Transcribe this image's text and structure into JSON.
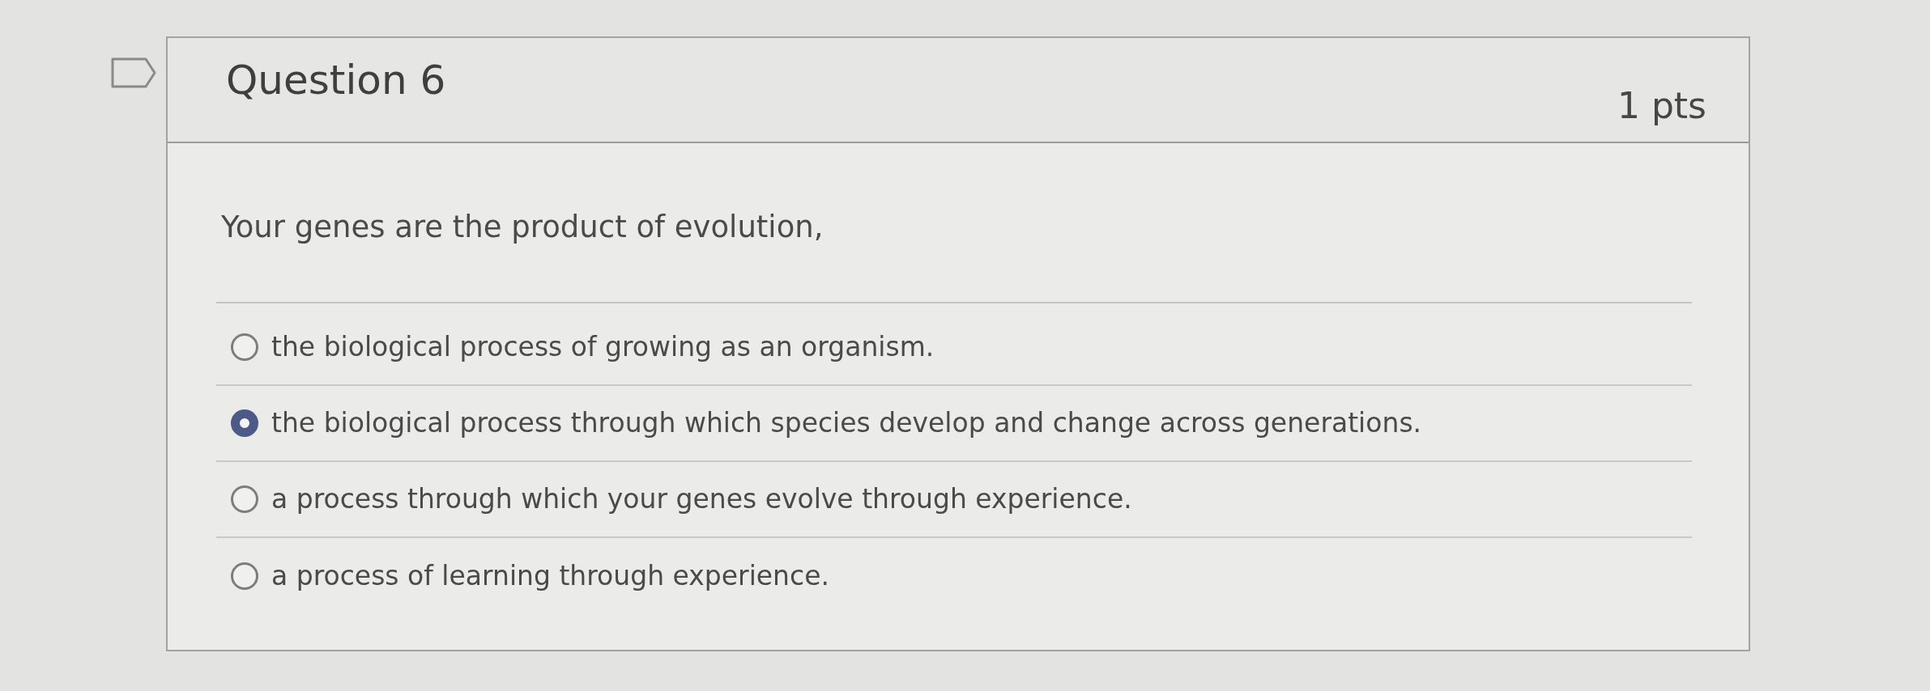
{
  "question": {
    "title": "Question 6",
    "points": "1 pts",
    "text": "Your genes are the product of evolution,",
    "answers": [
      {
        "label": "the biological process of growing as an organism.",
        "selected": false
      },
      {
        "label": "the biological process through which species develop and change across generations.",
        "selected": true
      },
      {
        "label": "a process through which your genes evolve through experience.",
        "selected": false
      },
      {
        "label": "a process of learning through experience.",
        "selected": false
      }
    ]
  }
}
